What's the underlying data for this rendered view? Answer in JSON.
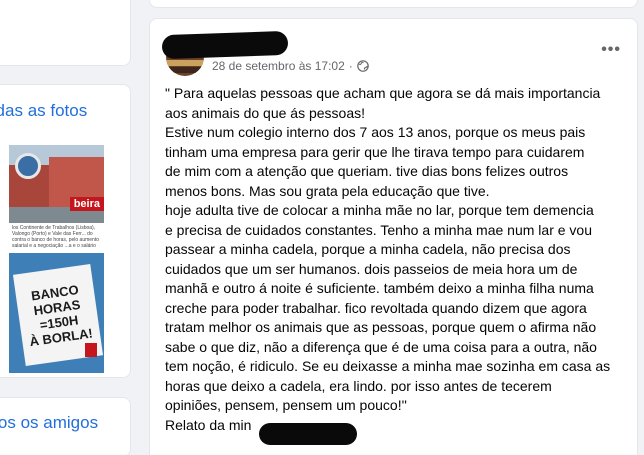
{
  "sidebar": {
    "see_all_photos": "r todas as fotos",
    "see_all_friends": "odos os amigos",
    "photos": [
      {
        "caption_banner": "beira",
        "caption_text": "los Continente de Trabalhos (Lisboa), Valongo (Porto) e Vale das Ferr... do contra o banco de horas, pelo aumento salarial e a negociação ...a e o salário"
      },
      {
        "sign_lines": [
          "BANCO HORAS",
          "=150H",
          "À BORLA!"
        ]
      }
    ]
  },
  "post": {
    "timestamp": "28 de setembro às 17:02",
    "separator": "·",
    "lines": [
      "\" Para aquelas pessoas que acham que agora se dá mais importancia",
      "aos animais do que ás pessoas!",
      "Estive num colegio interno dos 7 aos 13 anos, porque os meus pais",
      "tinham uma empresa para gerir que lhe tirava tempo para cuidarem",
      "de mim com a atenção que queriam. tive dias bons felizes outros",
      "menos bons. Mas sou grata pela educação que tive.",
      "hoje adulta tive de colocar a minha mãe no lar, porque tem demencia",
      "e precisa de cuidados constantes. Tenho a minha mae num lar e vou",
      "passear a minha cadela, porque a minha cadela, não precisa dos",
      "cuidados que um ser humanos. dois passeios de meia hora um de",
      "manhã e outro á noite é suficiente. também deixo a minha filha numa",
      "creche para poder trabalhar. fico revoltada quando dizem que agora",
      "tratam melhor os animais que as pessoas, porque quem o afirma não",
      "sabe o que diz, não a diferença que é de uma coisa para a outra, não",
      "tem noção, é ridiculo. Se eu deixasse a minha mae sozinha em casa as",
      "horas que deixo a cadela, era lindo. por isso antes de tecerem",
      "opiniões, pensem, pensem um pouco!''",
      "Relato da min"
    ]
  },
  "icons": {
    "globe": "globe-icon",
    "more": "more-options-icon"
  },
  "colors": {
    "link": "#216fdb",
    "text": "#050505",
    "meta": "#65676b",
    "background": "#f0f2f5"
  }
}
